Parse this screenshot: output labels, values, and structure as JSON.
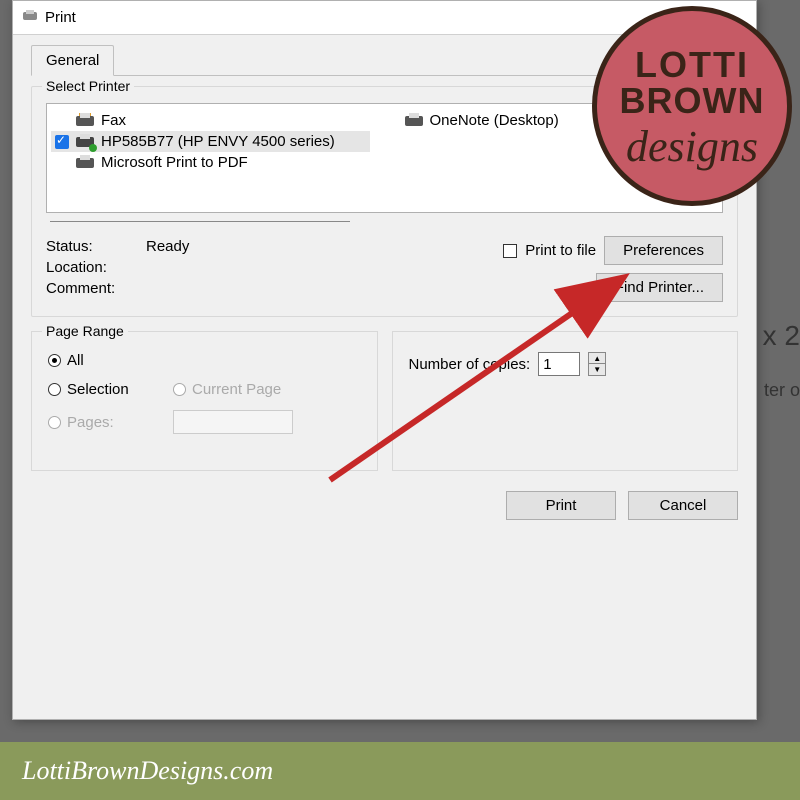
{
  "dialog": {
    "title": "Print",
    "tabs": [
      {
        "label": "General"
      }
    ]
  },
  "select_printer": {
    "legend": "Select Printer",
    "items_left": [
      {
        "label": "Fax",
        "checked": false,
        "selected": false
      },
      {
        "label": "HP585B77 (HP ENVY 4500 series)",
        "checked": true,
        "selected": true
      },
      {
        "label": "Microsoft Print to PDF",
        "checked": false,
        "selected": false
      }
    ],
    "items_right": [
      {
        "label": "OneNote (Desktop)",
        "checked": false,
        "selected": false
      }
    ]
  },
  "status": {
    "status_label": "Status:",
    "status_value": "Ready",
    "location_label": "Location:",
    "location_value": "",
    "comment_label": "Comment:",
    "comment_value": "",
    "print_to_file_label": "Print to file",
    "print_to_file_checked": false,
    "preferences_button": "Preferences",
    "find_printer_button": "Find Printer..."
  },
  "page_range": {
    "legend": "Page Range",
    "all_label": "All",
    "selection_label": "Selection",
    "current_page_label": "Current Page",
    "pages_label": "Pages:",
    "selected": "all"
  },
  "copies": {
    "label": "Number of copies:",
    "value": "1"
  },
  "buttons": {
    "print": "Print",
    "cancel": "Cancel"
  },
  "background": {
    "text1": "x 2",
    "text2": "ter o"
  },
  "watermark": {
    "line1": "LOTTI",
    "line2": "BROWN",
    "line3": "designs"
  },
  "footer": {
    "text": "LottiBrownDesigns.com"
  }
}
